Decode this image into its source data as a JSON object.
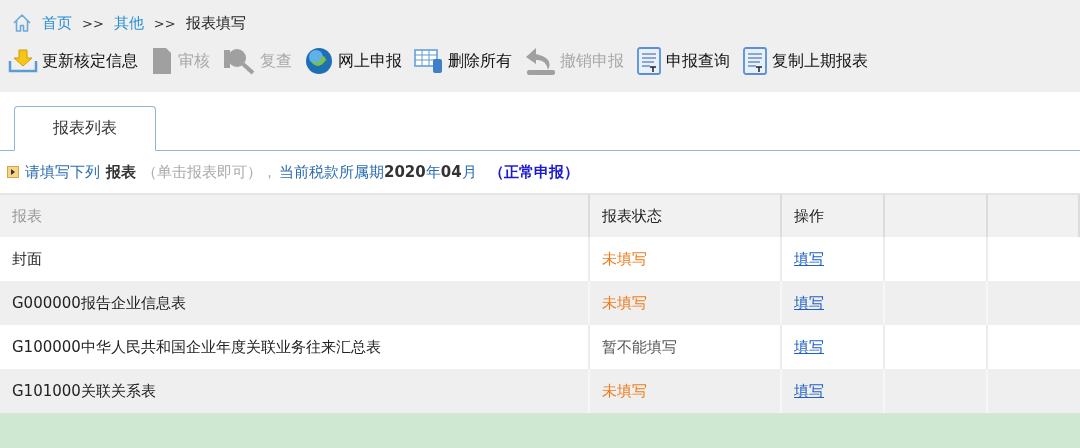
{
  "breadcrumb": [
    {
      "label": "首页",
      "link": true
    },
    {
      "label": "其他",
      "link": true
    },
    {
      "label": "报表填写",
      "link": false
    }
  ],
  "breadcrumb_separator": ">>",
  "toolbar": [
    {
      "kind": "download",
      "label": "更新核定信息",
      "disabled": false
    },
    {
      "kind": "doc",
      "label": "审核",
      "disabled": true
    },
    {
      "kind": "search",
      "label": "复查",
      "disabled": true
    },
    {
      "kind": "globe",
      "label": "网上申报",
      "disabled": false
    },
    {
      "kind": "table",
      "label": "删除所有",
      "disabled": false
    },
    {
      "kind": "undo",
      "label": "撤销申报",
      "disabled": true
    },
    {
      "kind": "report",
      "label": "申报查询",
      "disabled": false
    },
    {
      "kind": "report",
      "label": "复制上期报表",
      "disabled": false
    }
  ],
  "tabs": [
    {
      "label": "报表列表",
      "selected": true
    }
  ],
  "notice": [
    {
      "kind": "link",
      "text": "请填写下列"
    },
    {
      "kind": "strong",
      "text": "报表"
    },
    {
      "kind": "hint",
      "text": "（单击报表即可），"
    },
    {
      "kind": "period",
      "text": "当前税款所属期**2020**年**04**月"
    },
    {
      "kind": "mode",
      "text": "（正常申报）"
    }
  ],
  "table": {
    "columns": [
      "报表",
      "报表状态",
      "操作"
    ],
    "rows": [
      {
        "name": "封面",
        "status": {
          "text": "未填写",
          "color": "#f07a1c"
        },
        "action": "填写"
      },
      {
        "name": "G000000报告企业信息表",
        "status": {
          "text": "未填写",
          "color": "#f07a1c"
        },
        "action": "填写"
      },
      {
        "name": "G100000中华人民共和国企业年度关联业务往来汇总表",
        "status": {
          "text": "暂不能填写",
          "color": "#555555"
        },
        "action": "填写"
      },
      {
        "name": "G101000关联关系表",
        "status": {
          "text": "未填写",
          "color": "#f07a1c"
        },
        "action": "填写"
      }
    ]
  }
}
